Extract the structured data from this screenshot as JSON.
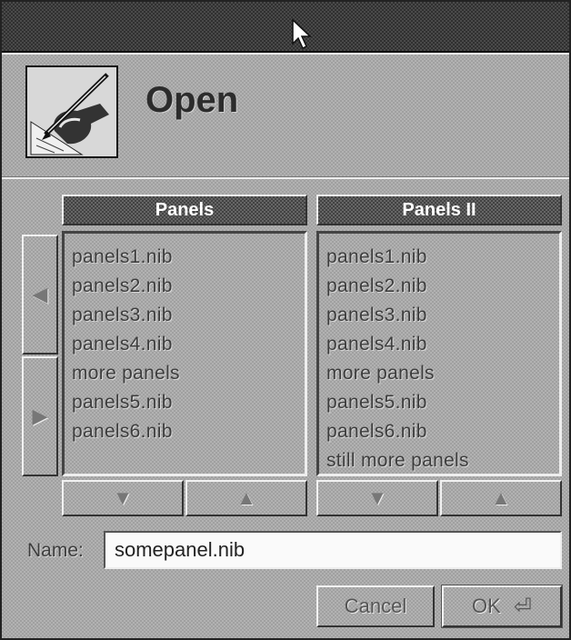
{
  "dialog": {
    "title": "Open"
  },
  "browser": {
    "columns": [
      {
        "header": "Panels",
        "items": [
          "panels1.nib",
          "panels2.nib",
          "panels3.nib",
          "panels4.nib",
          "more panels",
          "panels5.nib",
          "panels6.nib"
        ]
      },
      {
        "header": "Panels II",
        "items": [
          "panels1.nib",
          "panels2.nib",
          "panels3.nib",
          "panels4.nib",
          "more panels",
          "panels5.nib",
          "panels6.nib",
          "still more panels"
        ]
      }
    ]
  },
  "name_field": {
    "label": "Name:",
    "value": "somepanel.nib"
  },
  "buttons": {
    "cancel": "Cancel",
    "ok": "OK",
    "ok_glyph": "⏎"
  },
  "icons": {
    "scroll_left": "◀",
    "scroll_right": "▶",
    "scroll_down": "▼",
    "scroll_up": "▲"
  },
  "colors": {
    "titlebar": "#4a4a4a",
    "panel_gray": "#b2b2b2",
    "column_header": "#666666"
  }
}
